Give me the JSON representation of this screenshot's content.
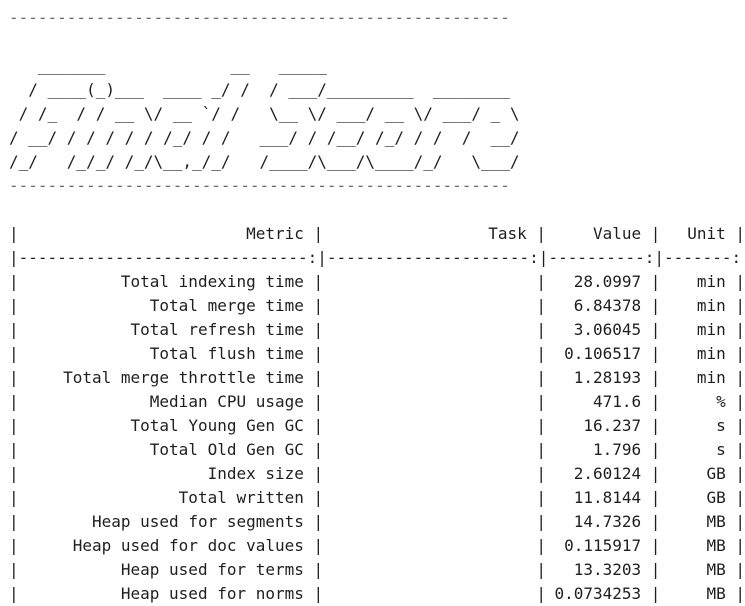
{
  "terminal": {
    "rule_top": "----------------------------------------------------",
    "banner": [
      "   _______             __   _____",
      "  / ____(_)___  ____ _/ /  / ___/_________  ________",
      " / /_  / / __ \\/ __ `/ /   \\__ \\/ ___/ __ \\/ ___/ _ \\",
      "/ __/ / / / / / /_/ / /   ___/ / /__/ /_/ / /  /  __/",
      "/_/   /_/_/ /_/\\__,_/_/   /____/\\___/\\____/_/   \\___/"
    ],
    "rule_bottom": "----------------------------------------------------"
  },
  "table": {
    "headers": {
      "metric": "Metric",
      "task": "Task",
      "value": "Value",
      "unit": "Unit"
    },
    "separator": "|------------------------------:|---------------------:|----------:|-------:|",
    "rows": [
      {
        "metric": "Total indexing time",
        "task": "",
        "value": "28.0997",
        "unit": "min"
      },
      {
        "metric": "Total merge time",
        "task": "",
        "value": "6.84378",
        "unit": "min"
      },
      {
        "metric": "Total refresh time",
        "task": "",
        "value": "3.06045",
        "unit": "min"
      },
      {
        "metric": "Total flush time",
        "task": "",
        "value": "0.106517",
        "unit": "min"
      },
      {
        "metric": "Total merge throttle time",
        "task": "",
        "value": "1.28193",
        "unit": "min"
      },
      {
        "metric": "Median CPU usage",
        "task": "",
        "value": "471.6",
        "unit": "%"
      },
      {
        "metric": "Total Young Gen GC",
        "task": "",
        "value": "16.237",
        "unit": "s"
      },
      {
        "metric": "Total Old Gen GC",
        "task": "",
        "value": "1.796",
        "unit": "s"
      },
      {
        "metric": "Index size",
        "task": "",
        "value": "2.60124",
        "unit": "GB"
      },
      {
        "metric": "Total written",
        "task": "",
        "value": "11.8144",
        "unit": "GB"
      },
      {
        "metric": "Heap used for segments",
        "task": "",
        "value": "14.7326",
        "unit": "MB"
      },
      {
        "metric": "Heap used for doc values",
        "task": "",
        "value": "0.115917",
        "unit": "MB"
      },
      {
        "metric": "Heap used for terms",
        "task": "",
        "value": "13.3203",
        "unit": "MB"
      },
      {
        "metric": "Heap used for norms",
        "task": "",
        "value": "0.0734253",
        "unit": "MB"
      }
    ]
  }
}
